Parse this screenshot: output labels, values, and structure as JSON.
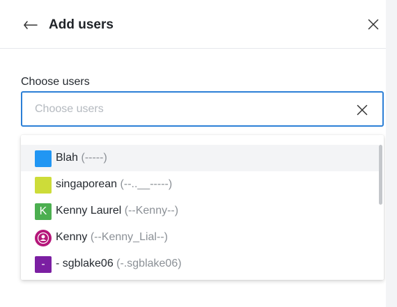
{
  "header": {
    "title": "Add users"
  },
  "field": {
    "label": "Choose users",
    "placeholder": "Choose users",
    "value": ""
  },
  "options": [
    {
      "name": "Blah",
      "handle": "(-----)",
      "avatar_color": "#2196f3",
      "avatar_text": ""
    },
    {
      "name": "singaporean",
      "handle": "(--..__-----)",
      "avatar_color": "#cddc39",
      "avatar_text": ""
    },
    {
      "name": "Kenny Laurel",
      "handle": "(--Kenny--)",
      "avatar_color": "#4caf50",
      "avatar_text": "K"
    },
    {
      "name": "Kenny",
      "handle": "(--Kenny_Lial--)",
      "avatar_color": "#b5177a",
      "avatar_text": ""
    },
    {
      "name": "- sgblake06",
      "handle": "(-.sgblake06)",
      "avatar_color": "#7b1fa2",
      "avatar_text": "-"
    }
  ],
  "colors": {
    "focus_border": "#2b7fd6",
    "highlight_row": "#f3f4f6"
  }
}
